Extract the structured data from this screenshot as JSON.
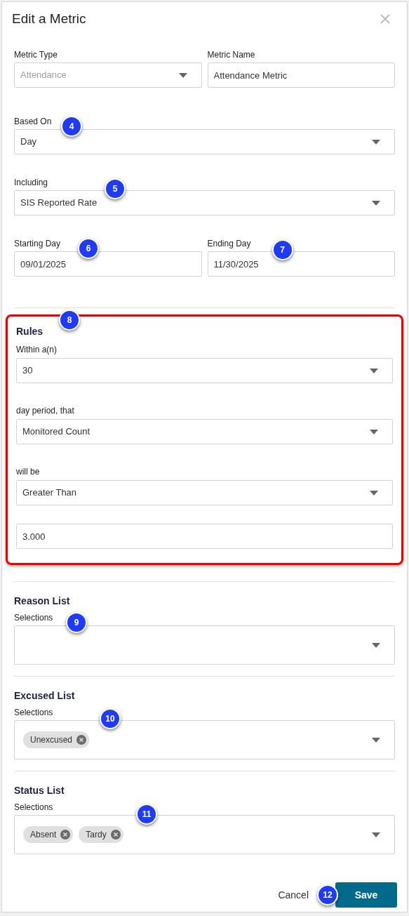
{
  "dialog": {
    "title": "Edit a Metric"
  },
  "rows": [
    {
      "fields": [
        {
          "kind": "select",
          "label": "Metric Type",
          "value": "Attendance",
          "disabled": true
        },
        {
          "kind": "text",
          "label": "Metric Name",
          "value": "Attendance Metric",
          "disabled": false
        }
      ]
    },
    {
      "fields": [
        {
          "kind": "select",
          "label": "Based On",
          "value": "Day",
          "disabled": false,
          "callout": "4"
        }
      ]
    },
    {
      "fields": [
        {
          "kind": "select",
          "label": "Including",
          "value": "SIS Reported Rate",
          "disabled": false,
          "callout": "5"
        }
      ]
    },
    {
      "fields": [
        {
          "kind": "text",
          "label": "Starting Day",
          "value": "09/01/2025",
          "disabled": false,
          "callout": "6"
        },
        {
          "kind": "text",
          "label": "Ending Day",
          "value": "11/30/2025",
          "disabled": false,
          "callout": "7"
        }
      ]
    }
  ],
  "rules": {
    "title": "Rules",
    "callout": "8",
    "highlighted": true,
    "fields": [
      {
        "kind": "select",
        "label": "Within a(n)",
        "value": "30"
      },
      {
        "kind": "select",
        "label": "day period, that",
        "value": "Monitored Count"
      },
      {
        "kind": "select",
        "label": "will be",
        "value": "Greater Than"
      },
      {
        "kind": "text",
        "value": "3.000"
      }
    ]
  },
  "lists": [
    {
      "title": "Reason List",
      "label": "Selections",
      "callout": "9"
    },
    {
      "title": "Excused List",
      "label": "Selections",
      "callout": "10",
      "chips": [
        "Unexcused"
      ]
    },
    {
      "title": "Status List",
      "label": "Selections",
      "callout": "11",
      "chips": [
        "Absent",
        "Tardy"
      ]
    }
  ],
  "footer": {
    "cancel": "Cancel",
    "save": "Save",
    "callout": "12"
  }
}
